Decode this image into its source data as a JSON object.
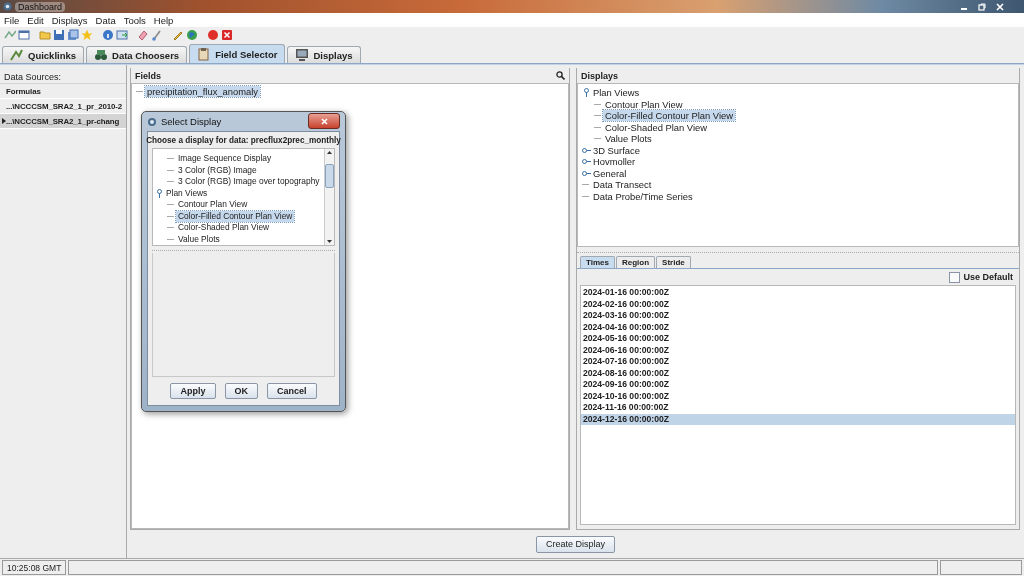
{
  "window": {
    "title": "Dashboard"
  },
  "menu": [
    "File",
    "Edit",
    "Displays",
    "Data",
    "Tools",
    "Help"
  ],
  "main_tabs": [
    {
      "label": "Quicklinks",
      "selected": false
    },
    {
      "label": "Data Choosers",
      "selected": false
    },
    {
      "label": "Field Selector",
      "selected": true
    },
    {
      "label": "Displays",
      "selected": false
    }
  ],
  "data_sources": {
    "label": "Data Sources:",
    "items": [
      {
        "label": "Formulas",
        "kind": "heading"
      },
      {
        "label": "...\\NCCCSM_SRA2_1_pr_2010-2",
        "kind": "source",
        "selected": false
      },
      {
        "label": "...\\NCCCSM_SRA2_1_pr-chang",
        "kind": "source",
        "selected": true
      }
    ]
  },
  "fields": {
    "label": "Fields",
    "tree": [
      {
        "label": "precipitation_flux_anomaly",
        "selected": true
      }
    ]
  },
  "dialog": {
    "title": "Select Display",
    "prompt": "Choose a display for data: precflux2prec_monthly",
    "tree": [
      {
        "children": [
          {
            "label": "Image Sequence Display",
            "selected": false
          },
          {
            "label": "3 Color (RGB) Image",
            "selected": false
          },
          {
            "label": "3 Color (RGB) Image over topography",
            "selected": false
          }
        ]
      },
      {
        "label": "Plan Views",
        "expanded": true,
        "selected": false,
        "children": [
          {
            "label": "Contour Plan View",
            "selected": false
          },
          {
            "label": "Color-Filled Contour Plan View",
            "selected": true
          },
          {
            "label": "Color-Shaded Plan View",
            "selected": false
          },
          {
            "label": "Value Plots",
            "selected": false
          }
        ]
      }
    ],
    "buttons": [
      "Apply",
      "OK",
      "Cancel"
    ]
  },
  "displays": {
    "label": "Displays",
    "tree": [
      {
        "label": "Plan Views",
        "expanded": true,
        "selected": false,
        "children": [
          {
            "label": "Contour Plan View",
            "selected": false
          },
          {
            "label": "Color-Filled Contour Plan View",
            "selected": true
          },
          {
            "label": "Color-Shaded Plan View",
            "selected": false
          },
          {
            "label": "Value Plots",
            "selected": false
          }
        ]
      },
      {
        "label": "3D Surface",
        "expanded": false,
        "selected": false
      },
      {
        "label": "Hovmoller",
        "expanded": false,
        "selected": false
      },
      {
        "label": "General",
        "expanded": false,
        "selected": false
      },
      {
        "label": "Data Transect",
        "selected": false
      },
      {
        "label": "Data Probe/Time Series",
        "selected": false
      }
    ]
  },
  "subset_tabs": [
    {
      "label": "Times",
      "selected": true
    },
    {
      "label": "Region",
      "selected": false
    },
    {
      "label": "Stride",
      "selected": false
    }
  ],
  "use_default": {
    "label": "Use Default",
    "checked": false
  },
  "times": [
    {
      "label": "2024-01-16 00:00:00Z",
      "selected": false
    },
    {
      "label": "2024-02-16 00:00:00Z",
      "selected": false
    },
    {
      "label": "2024-03-16 00:00:00Z",
      "selected": false
    },
    {
      "label": "2024-04-16 00:00:00Z",
      "selected": false
    },
    {
      "label": "2024-05-16 00:00:00Z",
      "selected": false
    },
    {
      "label": "2024-06-16 00:00:00Z",
      "selected": false
    },
    {
      "label": "2024-07-16 00:00:00Z",
      "selected": false
    },
    {
      "label": "2024-08-16 00:00:00Z",
      "selected": false
    },
    {
      "label": "2024-09-16 00:00:00Z",
      "selected": false
    },
    {
      "label": "2024-10-16 00:00:00Z",
      "selected": false
    },
    {
      "label": "2024-11-16 00:00:00Z",
      "selected": false
    },
    {
      "label": "2024-12-16 00:00:00Z",
      "selected": true
    }
  ],
  "create_button": "Create Display",
  "status": {
    "time": "10:25:08 GMT"
  }
}
